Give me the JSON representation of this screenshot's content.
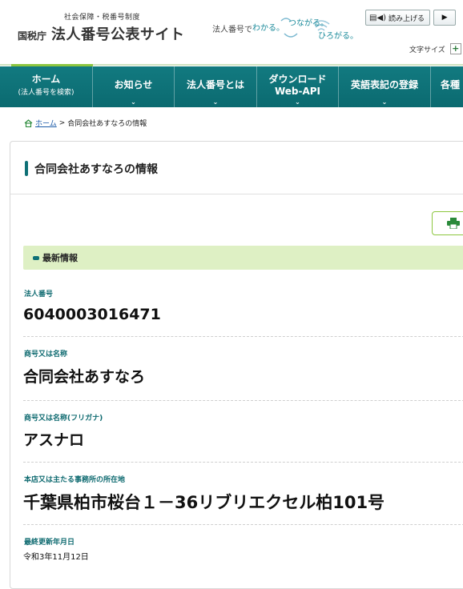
{
  "header": {
    "logo_sub": "社会保障・税番号制度",
    "logo_agency": "国税庁",
    "logo_title": "法人番号公表サイト",
    "tagline": {
      "prefix": "法人番号で",
      "wakaru": "わかる。",
      "tsunagaru": "つながる。",
      "hirogaru": "ひろがる。"
    },
    "read_aloud": "読み上げる",
    "font_size_label": "文字サイズ",
    "font_size_plus": "+"
  },
  "nav": {
    "items": [
      {
        "label": "ホーム",
        "sub": "(法人番号を検索)",
        "has_menu": false
      },
      {
        "label": "お知らせ",
        "has_menu": true
      },
      {
        "label": "法人番号とは",
        "has_menu": true
      },
      {
        "label": "ダウンロード",
        "line2": "Web-API",
        "has_menu": true
      },
      {
        "label": "英語表記の登録",
        "has_menu": true
      },
      {
        "label": "各種",
        "has_menu": false
      }
    ]
  },
  "breadcrumb": {
    "home": "ホーム",
    "separator": ">",
    "current": "合同会社あすなろの情報"
  },
  "card": {
    "title": "合同会社あすなろの情報",
    "section": "最新情報",
    "fields": [
      {
        "label": "法人番号",
        "value": "6040003016471"
      },
      {
        "label": "商号又は名称",
        "value": "合同会社あすなろ"
      },
      {
        "label": "商号又は名称(フリガナ)",
        "value": "アスナロ"
      },
      {
        "label": "本店又は主たる事務所の所在地",
        "value": "千葉県柏市桜台１－36リブリエクセル柏101号"
      },
      {
        "label": "最終更新年月日",
        "value": "令和3年11月12日"
      }
    ]
  },
  "colors": {
    "nav_bg": "#0b6a70",
    "accent_green": "#8dc63f",
    "section_bg": "#def0c4",
    "label_teal": "#0e6a70",
    "link_blue": "#1a5aa8"
  }
}
